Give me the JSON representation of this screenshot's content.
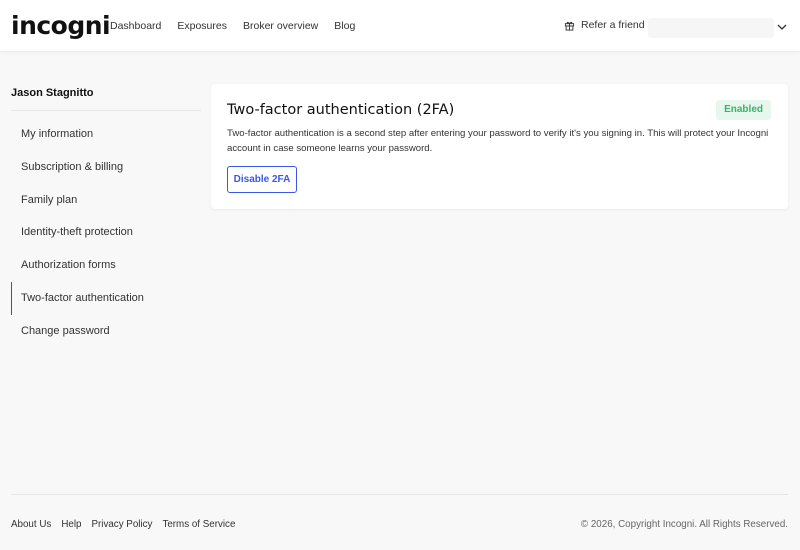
{
  "header": {
    "logo_text": "incogni",
    "nav": [
      "Dashboard",
      "Exposures",
      "Broker overview",
      "Blog"
    ],
    "refer_label": "Refer a friend",
    "account_value": ""
  },
  "sidebar": {
    "user_name": "Jason Stagnitto",
    "items": [
      {
        "label": "My information"
      },
      {
        "label": "Subscription & billing"
      },
      {
        "label": "Family plan"
      },
      {
        "label": "Identity-theft protection"
      },
      {
        "label": "Authorization forms"
      },
      {
        "label": "Two-factor authentication"
      },
      {
        "label": "Change password"
      }
    ]
  },
  "card": {
    "title": "Two-factor authentication (2FA)",
    "status": "Enabled",
    "description": "Two-factor authentication is a second step after entering your password to verify it's you signing in. This will protect your Incogni account in case someone learns your password.",
    "button_label": "Disable 2FA"
  },
  "footer": {
    "links": [
      "About Us",
      "Help",
      "Privacy Policy",
      "Terms of Service"
    ],
    "copyright": "© 2026, Copyright Incogni. All Rights Reserved."
  },
  "colors": {
    "accent": "#3a57e8",
    "enabled_text": "#3bb36a",
    "enabled_bg": "#e7f7ee",
    "page_bg": "#f8f8f8"
  },
  "icons": {
    "refer": "gift-icon",
    "account": "chevron-down-icon"
  }
}
